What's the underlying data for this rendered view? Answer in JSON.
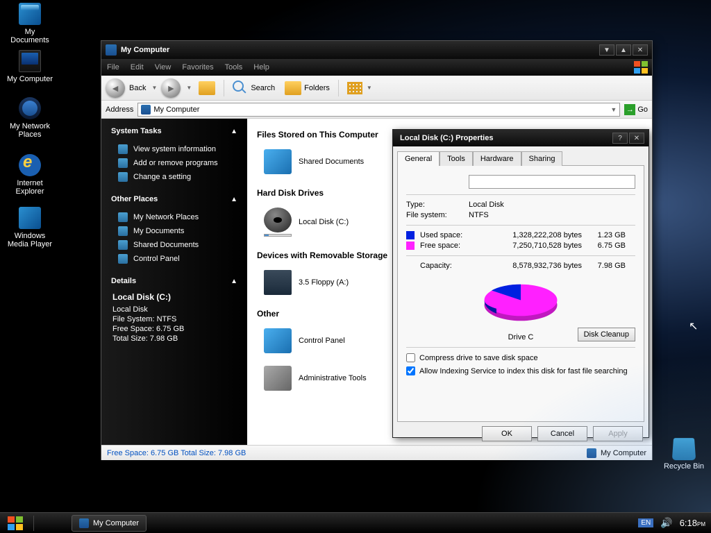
{
  "desktop_icons": [
    "My Documents",
    "My Computer",
    "My Network Places",
    "Internet Explorer",
    "Windows Media Player",
    "Recycle Bin"
  ],
  "explorer": {
    "title": "My Computer",
    "menu": [
      "File",
      "Edit",
      "View",
      "Favorites",
      "Tools",
      "Help"
    ],
    "toolbar": {
      "back": "Back",
      "search": "Search",
      "folders": "Folders"
    },
    "address_label": "Address",
    "address_value": "My Computer",
    "go": "Go",
    "sidebar": {
      "tasks_title": "System Tasks",
      "tasks": [
        "View system information",
        "Add or remove programs",
        "Change a setting"
      ],
      "places_title": "Other Places",
      "places": [
        "My Network Places",
        "My Documents",
        "Shared Documents",
        "Control Panel"
      ],
      "details_title": "Details",
      "details_name": "Local Disk (C:)",
      "details_type": "Local Disk",
      "details_fs": "File System: NTFS",
      "details_free": "Free Space: 6.75 GB",
      "details_total": "Total Size: 7.98 GB"
    },
    "content": {
      "sec1": "Files Stored on This Computer",
      "shared": "Shared Documents",
      "sec2": "Hard Disk Drives",
      "local": "Local Disk (C:)",
      "sec3": "Devices with Removable Storage",
      "floppy": "3.5 Floppy (A:)",
      "sec4": "Other",
      "cp": "Control Panel",
      "admin": "Administrative Tools"
    },
    "status_left": "Free Space: 6.75 GB Total Size: 7.98 GB",
    "status_right": "My Computer"
  },
  "props": {
    "title": "Local Disk (C:) Properties",
    "tabs": [
      "General",
      "Tools",
      "Hardware",
      "Sharing"
    ],
    "type_label": "Type:",
    "type_val": "Local Disk",
    "fs_label": "File system:",
    "fs_val": "NTFS",
    "used_label": "Used space:",
    "used_bytes": "1,328,222,208 bytes",
    "used_gb": "1.23 GB",
    "free_label": "Free space:",
    "free_bytes": "7,250,710,528 bytes",
    "free_gb": "6.75 GB",
    "cap_label": "Capacity:",
    "cap_bytes": "8,578,932,736 bytes",
    "cap_gb": "7.98 GB",
    "drive_label": "Drive C",
    "cleanup": "Disk Cleanup",
    "compress": "Compress drive to save disk space",
    "index": "Allow Indexing Service to index this disk for fast file searching",
    "ok": "OK",
    "cancel": "Cancel",
    "apply": "Apply",
    "used_color": "#0020e0",
    "free_color": "#ff20ff"
  },
  "taskbar": {
    "task": "My Computer",
    "lang": "EN",
    "time": "6:18",
    "ampm": "PM"
  },
  "chart_data": {
    "type": "pie",
    "title": "Drive C",
    "series": [
      {
        "name": "Used space",
        "value_bytes": 1328222208,
        "value_gb": 1.23,
        "color": "#0020e0"
      },
      {
        "name": "Free space",
        "value_bytes": 7250710528,
        "value_gb": 6.75,
        "color": "#ff20ff"
      }
    ],
    "total_bytes": 8578932736,
    "total_gb": 7.98
  }
}
